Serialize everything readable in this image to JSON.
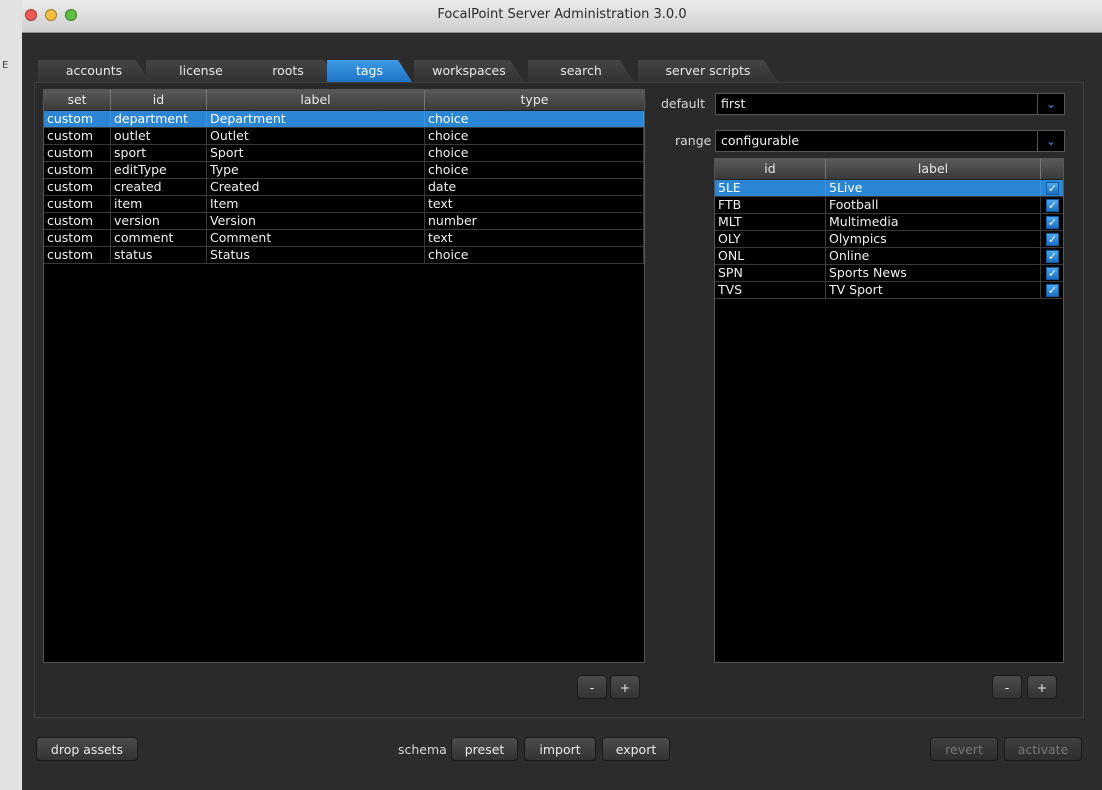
{
  "window": {
    "title": "FocalPoint Server Administration 3.0.0"
  },
  "colors": {
    "accent": "#2b87d6",
    "close": "#ee5a52",
    "minimize": "#f4be40",
    "zoom": "#5dc13f"
  },
  "tabs": [
    "accounts",
    "license",
    "roots",
    "tags",
    "workspaces",
    "search",
    "server scripts"
  ],
  "active_tab": "tags",
  "tags_table": {
    "columns": [
      "set",
      "id",
      "label",
      "type"
    ],
    "rows": [
      [
        "custom",
        "department",
        "Department",
        "choice"
      ],
      [
        "custom",
        "outlet",
        "Outlet",
        "choice"
      ],
      [
        "custom",
        "sport",
        "Sport",
        "choice"
      ],
      [
        "custom",
        "editType",
        "Type",
        "choice"
      ],
      [
        "custom",
        "created",
        "Created",
        "date"
      ],
      [
        "custom",
        "item",
        "Item",
        "text"
      ],
      [
        "custom",
        "version",
        "Version",
        "number"
      ],
      [
        "custom",
        "comment",
        "Comment",
        "text"
      ],
      [
        "custom",
        "status",
        "Status",
        "choice"
      ]
    ],
    "selected_row": 0,
    "remove_label": "-",
    "add_label": "+"
  },
  "details": {
    "default_label": "default",
    "default_value": "first",
    "range_label": "range",
    "range_value": "configurable",
    "range_table": {
      "columns": [
        "id",
        "label",
        ""
      ],
      "rows": [
        {
          "id": "5LE",
          "label": "5Live",
          "checked": true
        },
        {
          "id": "FTB",
          "label": "Football",
          "checked": true
        },
        {
          "id": "MLT",
          "label": "Multimedia",
          "checked": true
        },
        {
          "id": "OLY",
          "label": "Olympics",
          "checked": true
        },
        {
          "id": "ONL",
          "label": "Online",
          "checked": true
        },
        {
          "id": "SPN",
          "label": "Sports News",
          "checked": true
        },
        {
          "id": "TVS",
          "label": "TV Sport",
          "checked": true
        }
      ],
      "selected_row": 0
    },
    "remove_label": "-",
    "add_label": "+"
  },
  "footer": {
    "drop_assets": "drop assets",
    "schema_label": "schema",
    "preset": "preset",
    "import": "import",
    "export": "export",
    "revert": "revert",
    "activate": "activate"
  }
}
